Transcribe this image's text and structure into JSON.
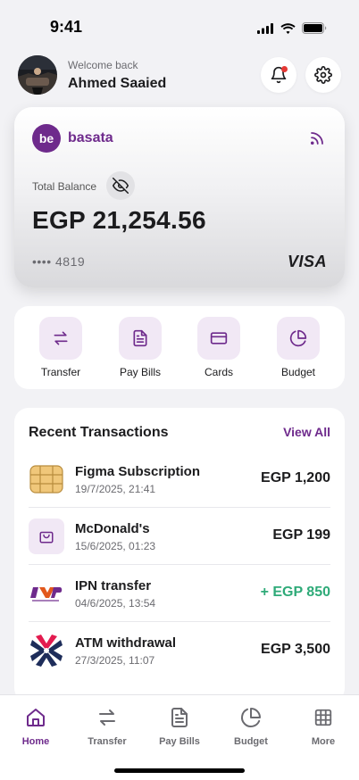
{
  "status_bar": {
    "time": "9:41"
  },
  "header": {
    "welcome": "Welcome back",
    "user_name": "Ahmed Saaied"
  },
  "card": {
    "brand_initials": "be",
    "brand_name": "basata",
    "balance_label": "Total Balance",
    "balance": "EGP 21,254.56",
    "card_number": "•••• 4819",
    "network": "VISA"
  },
  "actions": [
    {
      "label": "Transfer",
      "icon": "transfer-icon"
    },
    {
      "label": "Pay Bills",
      "icon": "bill-icon"
    },
    {
      "label": "Cards",
      "icon": "card-icon"
    },
    {
      "label": "Budget",
      "icon": "pie-chart-icon"
    }
  ],
  "transactions": {
    "title": "Recent Transactions",
    "view_all": "View All",
    "items": [
      {
        "name": "Figma Subscription",
        "date": "19/7/2025, 21:41",
        "amount": "EGP 1,200",
        "logo": "chip-icon"
      },
      {
        "name": "McDonald's",
        "date": "15/6/2025, 01:23",
        "amount": "EGP 199",
        "logo": "shopping-bag-icon"
      },
      {
        "name": "IPN transfer",
        "date": "04/6/2025, 13:54",
        "amount": "+ EGP 850",
        "logo": "instapay-logo"
      },
      {
        "name": "ATM withdrawal",
        "date": "27/3/2025, 11:07",
        "amount": "EGP 3,500",
        "logo": "atm-logo"
      }
    ]
  },
  "tabs": [
    {
      "label": "Home",
      "icon": "home-icon",
      "active": true
    },
    {
      "label": "Transfer",
      "icon": "transfer-icon",
      "active": false
    },
    {
      "label": "Pay Bills",
      "icon": "bill-icon",
      "active": false
    },
    {
      "label": "Budget",
      "icon": "pie-chart-icon",
      "active": false
    },
    {
      "label": "More",
      "icon": "grid-icon",
      "active": false
    }
  ],
  "colors": {
    "accent": "#6e2a8c",
    "positive": "#2eaa78",
    "accent_light": "#f1e8f5"
  }
}
